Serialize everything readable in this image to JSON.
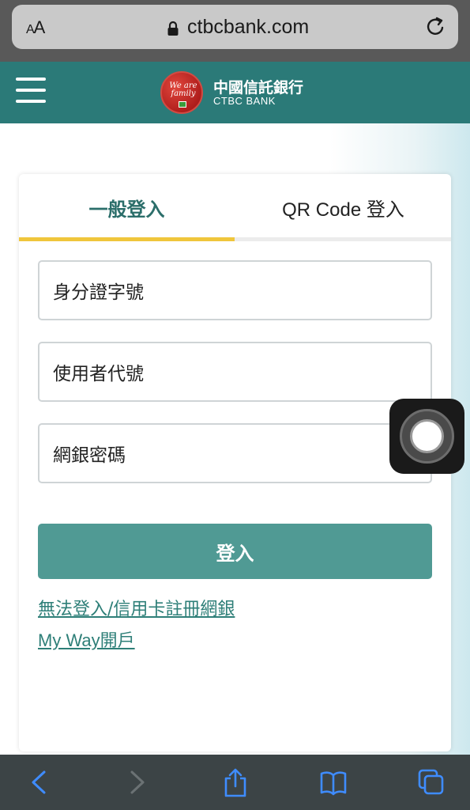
{
  "browser": {
    "text_size_label": "AA",
    "url": "ctbcbank.com"
  },
  "header": {
    "bank_name_cn": "中國信託銀行",
    "bank_name_en": "CTBC BANK",
    "logo_slogan": "We are family"
  },
  "tabs": [
    {
      "label": "一般登入",
      "active": true
    },
    {
      "label": "QR Code 登入",
      "active": false
    }
  ],
  "form": {
    "id_placeholder": "身分證字號",
    "user_placeholder": "使用者代號",
    "password_placeholder": "網銀密碼",
    "login_label": "登入"
  },
  "links": {
    "cannot_login": "無法登入/信用卡註冊網銀",
    "my_way": "My Way開戶"
  },
  "colors": {
    "header_teal": "#2b7a78",
    "button_teal": "#509a94",
    "tab_indicator": "#f0c63c",
    "link_teal": "#2e7f78"
  }
}
